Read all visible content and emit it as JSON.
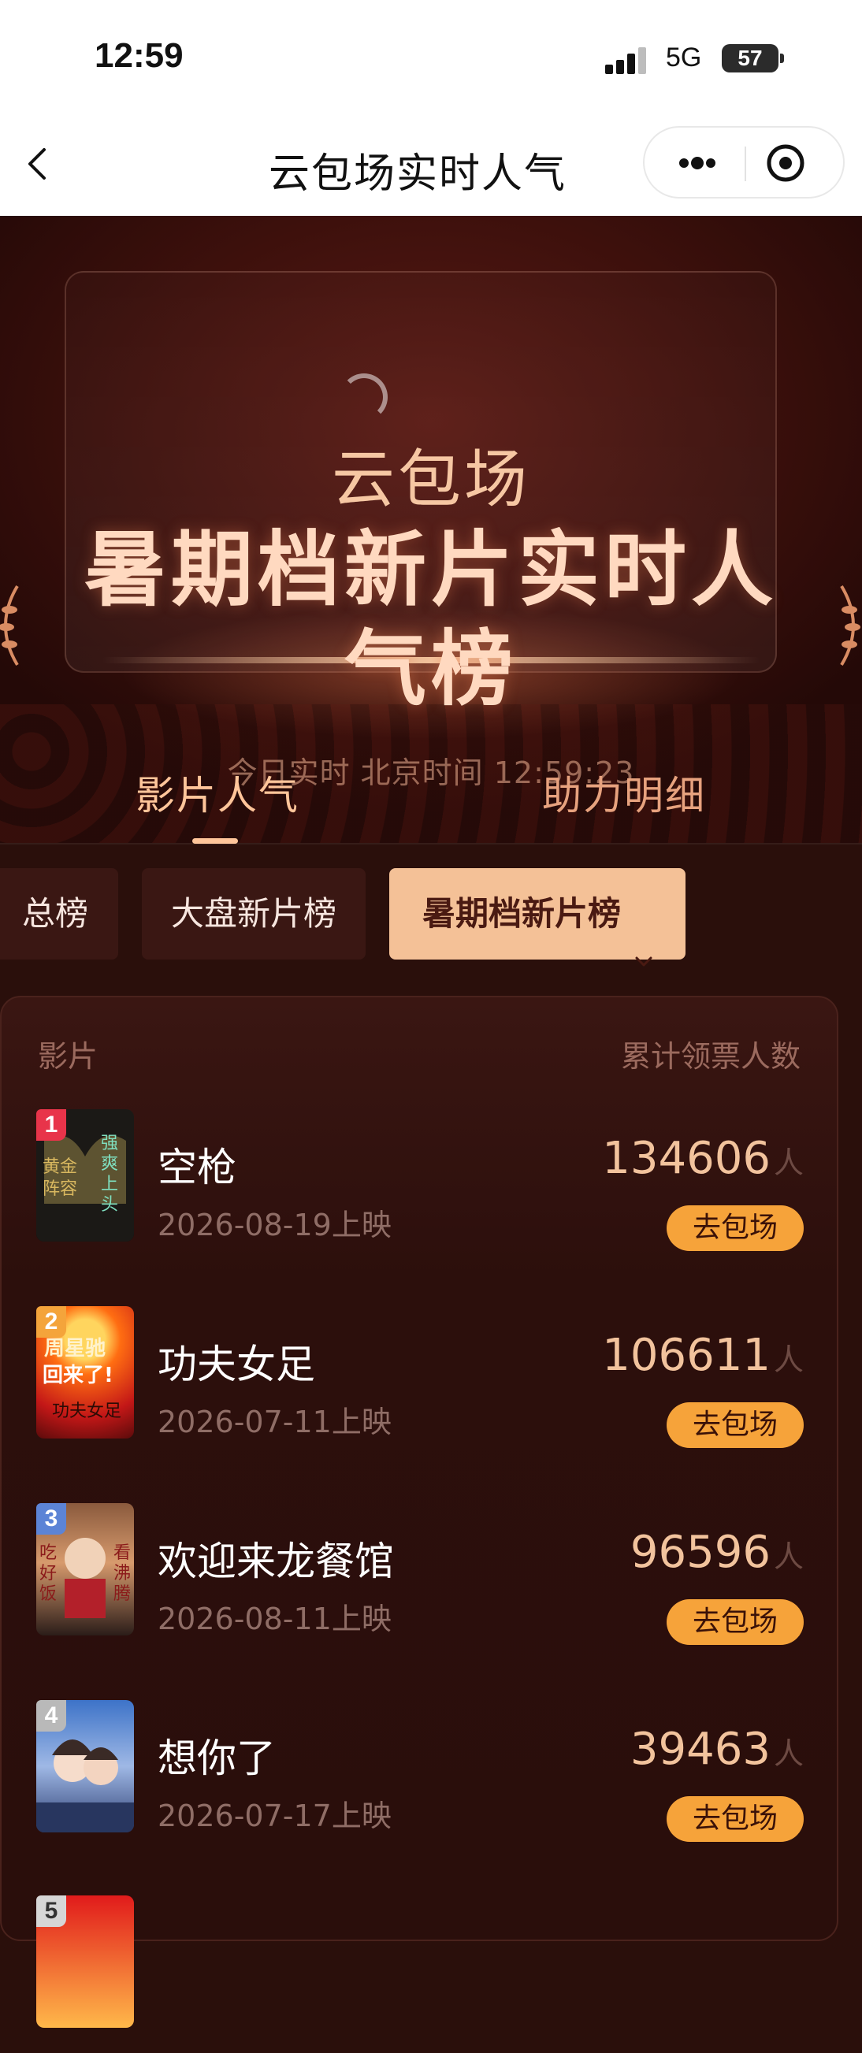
{
  "status_bar": {
    "time": "12:59",
    "network": "5G",
    "battery": "57"
  },
  "nav": {
    "title": "云包场实时人气",
    "back_icon": "chevron-left-icon",
    "more_icon": "more-dots-icon",
    "close_icon": "target-close-icon"
  },
  "hero": {
    "subtitle": "云包场",
    "title": "暑期档新片实时人气榜",
    "realtime_label": "今日实时 北京时间 12:59:23"
  },
  "main_tabs": [
    {
      "label": "影片人气",
      "active": true
    },
    {
      "label": "助力明细",
      "active": false
    }
  ],
  "sub_tabs": [
    {
      "label": "总榜"
    },
    {
      "label": "大盘新片榜"
    },
    {
      "label": "暑期档新片榜",
      "selected": true
    }
  ],
  "list": {
    "header_left": "影片",
    "header_right": "累计领票人数",
    "unit": "人",
    "button_label": "去包场",
    "items": [
      {
        "rank": "1",
        "title": "空枪",
        "date": "2026-08-19上映",
        "count": "134606",
        "poster_text": "黄金阵容 强爽上头"
      },
      {
        "rank": "2",
        "title": "功夫女足",
        "date": "2026-07-11上映",
        "count": "106611",
        "poster_text": "周星驰回来了!"
      },
      {
        "rank": "3",
        "title": "欢迎来龙餐馆",
        "date": "2026-08-11上映",
        "count": "96596",
        "poster_text": "吃好饭 看沸腾"
      },
      {
        "rank": "4",
        "title": "想你了",
        "date": "2026-07-17上映",
        "count": "39463",
        "poster_text": ""
      },
      {
        "rank": "5"
      }
    ]
  },
  "colors": {
    "accent": "#f6a33a",
    "tab_active": "#ffc59a",
    "subtab_selected_bg": "#f4c197",
    "bg": "#2a0f0b",
    "rank1": "#e8344a",
    "rank2": "#f4a43b",
    "rank3": "#5c84d6",
    "rank4": "#b9b9b9",
    "rank5": "#d6d6d6"
  }
}
